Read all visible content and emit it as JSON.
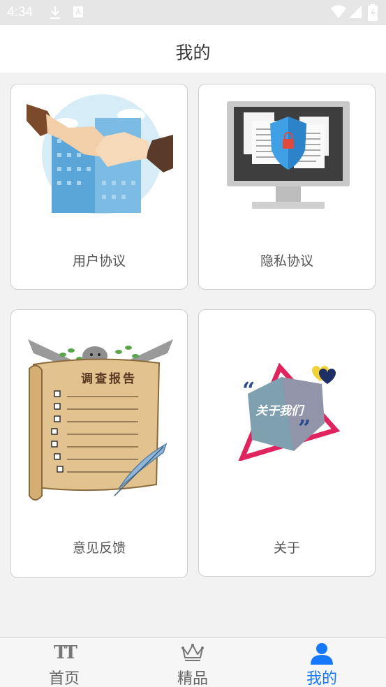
{
  "status_bar": {
    "time": "4:34"
  },
  "header": {
    "title": "我的"
  },
  "cards": [
    {
      "label": "用户协议"
    },
    {
      "label": "隐私协议"
    },
    {
      "label": "意见反馈",
      "art_text": "调查报告"
    },
    {
      "label": "关于",
      "art_text": "关于我们"
    }
  ],
  "bottom_nav": {
    "items": [
      {
        "label": "首页",
        "icon_text": "TT"
      },
      {
        "label": "精品"
      },
      {
        "label": "我的"
      }
    ],
    "active": "我的",
    "active_color": "#1677ff"
  }
}
